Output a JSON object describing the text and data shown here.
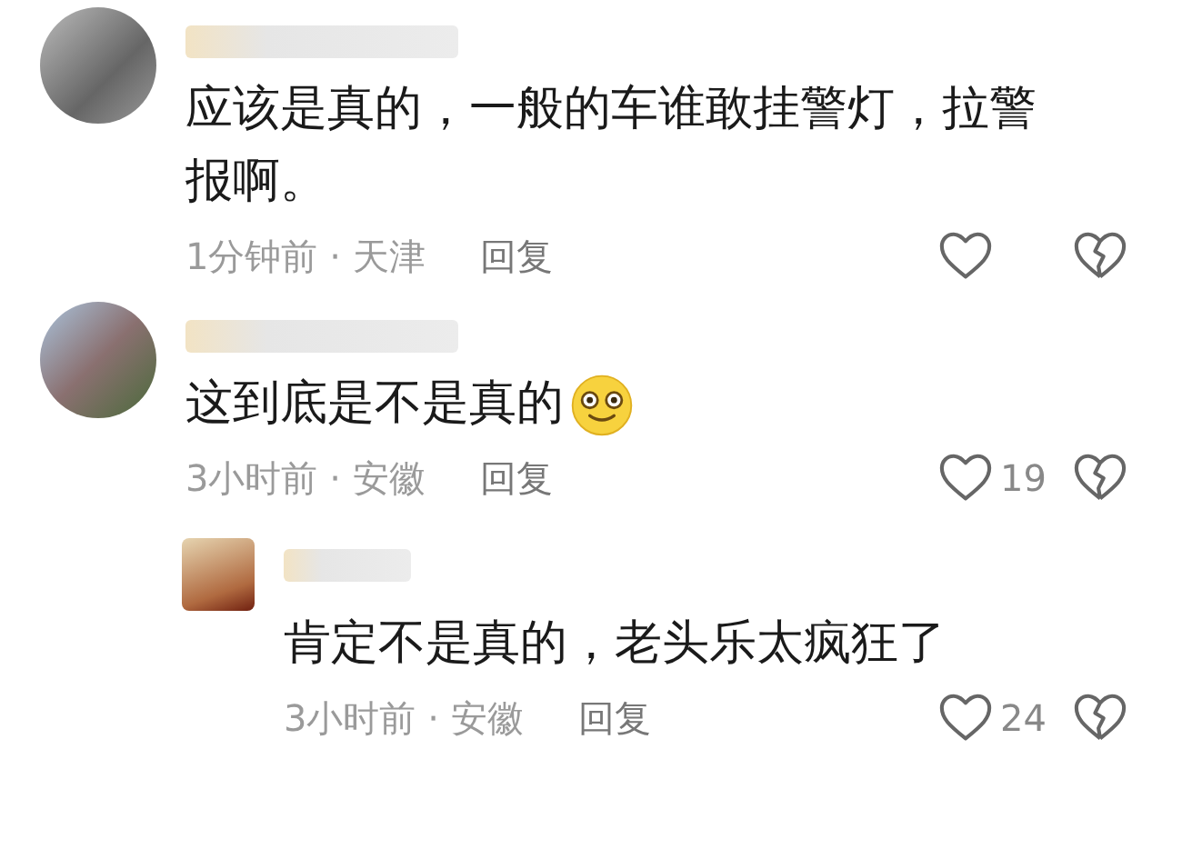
{
  "comments": [
    {
      "text": "应该是真的，一般的车谁敢挂警灯，拉警报啊。",
      "emoji": false,
      "meta": "1分钟前 · 天津",
      "reply": "回复"
    },
    {
      "text": "这到底是不是真的",
      "emoji": true,
      "meta": "3小时前 · 安徽",
      "reply": "回复",
      "likes": "19",
      "children": [
        {
          "text": "肯定不是真的，老头乐太疯狂了",
          "meta": "3小时前 · 安徽",
          "reply": "回复",
          "likes": "24"
        }
      ]
    }
  ]
}
